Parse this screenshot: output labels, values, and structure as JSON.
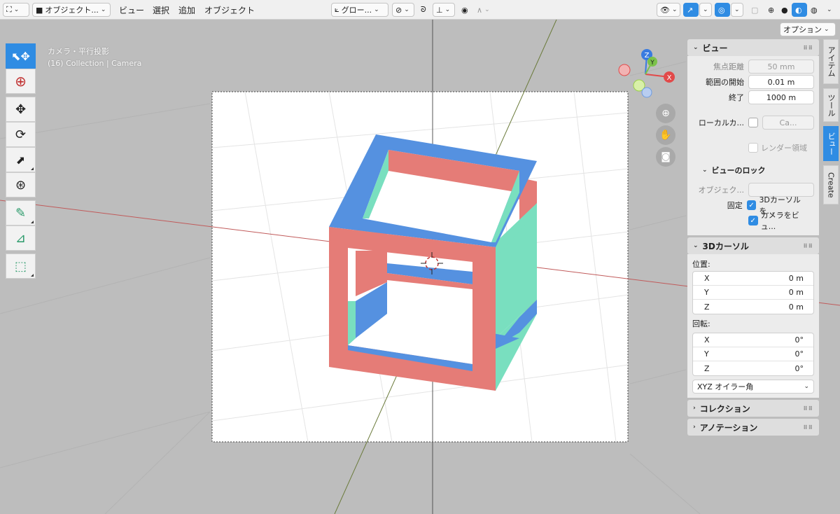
{
  "header": {
    "mode_label": "オブジェクト...",
    "menus": [
      "ビュー",
      "選択",
      "追加",
      "オブジェクト"
    ],
    "transform_orientation": "グロー...",
    "options_button": "オプション"
  },
  "viewport": {
    "view_name": "カメラ・平行投影",
    "collection_info": "(16) Collection | Camera",
    "gizmo": {
      "x": "X",
      "y": "Y",
      "z": "Z"
    }
  },
  "toolbar": {
    "tools": [
      "select-move-tool",
      "cursor-tool",
      "move-tool",
      "rotate-tool",
      "scale-tool",
      "transform-tool",
      "annotate-tool",
      "measure-tool",
      "add-cube-tool"
    ]
  },
  "colors": {
    "cube_top": "#5591e0",
    "cube_front": "#e57c77",
    "cube_side": "#79dfbf",
    "accent": "#2f8ce3"
  },
  "view_panel": {
    "title": "ビュー",
    "focal_length_label": "焦点距離",
    "focal_length_value": "50 mm",
    "clip_start_label": "範囲の開始",
    "clip_start_value": "0.01 m",
    "clip_end_label": "終了",
    "clip_end_value": "1000 m",
    "local_camera_label": "ローカルカ...",
    "local_camera_value": "Ca...",
    "render_region_label": "レンダー領域",
    "lock_title": "ビューのロック",
    "lock_object_label": "オブジェク...",
    "lock_label": "固定",
    "lock_3dcursor_label": "3Dカーソルを...",
    "lock_camera_label": "カメラをビュ..."
  },
  "cursor_panel": {
    "title": "3Dカーソル",
    "location_label": "位置:",
    "location": [
      {
        "axis": "X",
        "value": "0 m"
      },
      {
        "axis": "Y",
        "value": "0 m"
      },
      {
        "axis": "Z",
        "value": "0 m"
      }
    ],
    "rotation_label": "回転:",
    "rotation": [
      {
        "axis": "X",
        "value": "0°"
      },
      {
        "axis": "Y",
        "value": "0°"
      },
      {
        "axis": "Z",
        "value": "0°"
      }
    ],
    "rotation_mode": "XYZ オイラー角"
  },
  "collapsed_panels": [
    "コレクション",
    "アノテーション"
  ],
  "side_tabs": [
    "アイテム",
    "ツール",
    "ビュー",
    "Create"
  ]
}
